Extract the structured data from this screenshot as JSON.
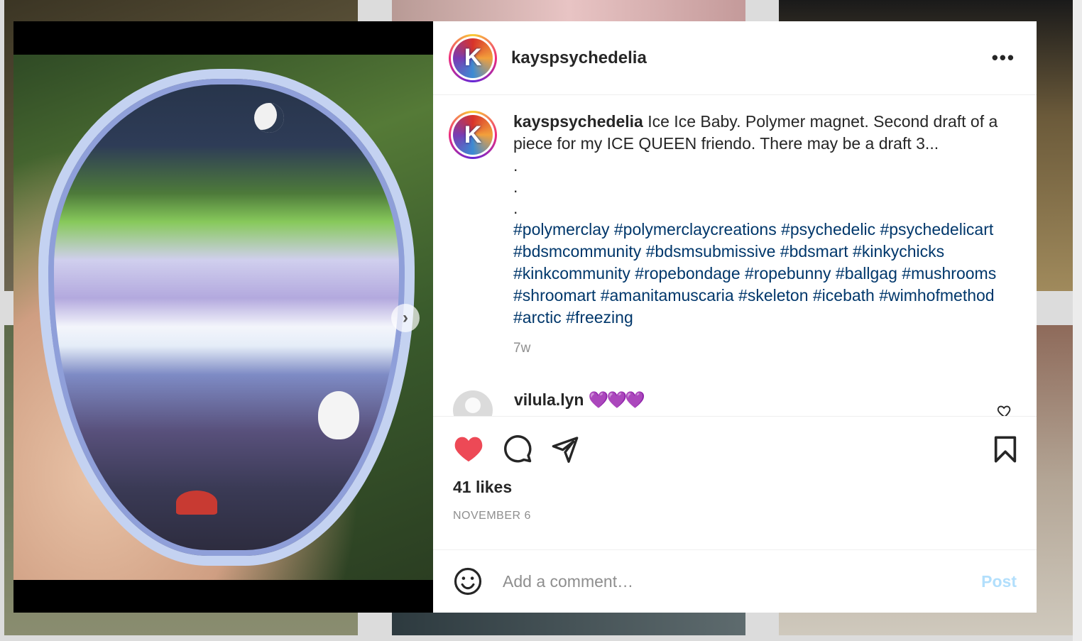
{
  "post": {
    "username": "kayspsychedelia",
    "avatar_letter": "K",
    "caption_text": "Ice Ice Baby. Polymer magnet. Second draft of a piece for my ICE QUEEN friendo. There may be a draft 3...",
    "caption_dots": [
      ".",
      ".",
      "."
    ],
    "hashtags": "#polymerclay #polymerclaycreations #psychedelic #psychedelicart #bdsmcommunity #bdsmsubmissive #bdsmart #kinkychicks #kinkcommunity #ropebondage #ropebunny #ballgag #mushrooms #shroomart #amanitamuscaria #skeleton #icebath #wimhofmethod #arctic #freezing",
    "time_ago": "7w",
    "likes": "41 likes",
    "date": "NOVEMBER 6"
  },
  "comment": {
    "username": "vilula.lyn",
    "text": "💜💜💜"
  },
  "comment_box": {
    "placeholder": "Add a comment…",
    "post_label": "Post"
  },
  "icons": {
    "more": "more-options-icon",
    "like": "heart-filled-icon",
    "comment": "comment-bubble-icon",
    "share": "paper-plane-icon",
    "save": "bookmark-icon",
    "emoji": "smiley-face-icon",
    "next": "chevron-right-icon",
    "comment_like": "heart-outline-icon"
  },
  "colors": {
    "like_red": "#ed4956",
    "hashtag_blue": "#00376b",
    "post_button_disabled": "#b2dffc",
    "muted_text": "#8e8e8e"
  }
}
